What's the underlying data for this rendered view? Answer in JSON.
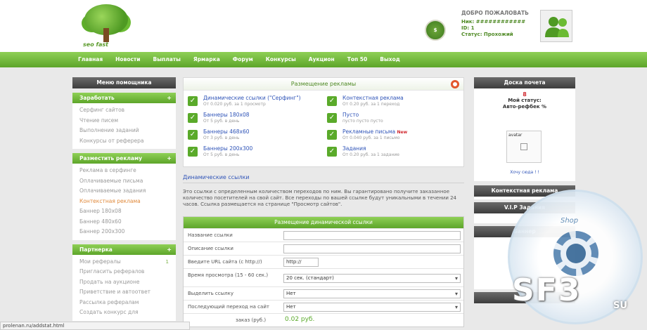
{
  "header": {
    "logo_text": "seo fast",
    "badge": "$",
    "welcome_title": "ДОБРО ПОЖАЛОВАТЬ",
    "login_row": "Ник: ############",
    "id_row": "ID: 1",
    "status_row": "Статус: Прохожий"
  },
  "nav": [
    "Главная",
    "Новости",
    "Выплаты",
    "Ярмарка",
    "Форум",
    "Конкурсы",
    "Аукцион",
    "Топ 50",
    "Выход"
  ],
  "left_menu": {
    "title": "Меню помощника",
    "sections": [
      {
        "title": "Заработать",
        "plus": "+",
        "items": [
          "Серфинг сайтов",
          "Чтение писем",
          "Выполнение заданий",
          "Конкурсы от реферера"
        ]
      },
      {
        "title": "Разместить рекламу",
        "plus": "+",
        "items": [
          "Реклама в серфинге",
          "Оплачиваемые письма",
          "Оплачиваемые задания",
          "Контекстная реклама",
          "Баннер 180х08",
          "Баннер 480х60",
          "Баннер 200х300"
        ],
        "active_index": 3
      },
      {
        "title": "Партнерка",
        "plus": "+",
        "items": [
          "Мои рефералы",
          "Пригласить рефералов",
          "Продать на аукционе",
          "Приветствие и автоответ",
          "Рассылка рефералам",
          "Создать конкурс для"
        ],
        "tiny_first": "1"
      }
    ]
  },
  "ads": {
    "title": "Размещение рекламы",
    "items": [
      {
        "title": "Динамические ссылки (\"Серфинг\")",
        "sub": "От 0.020 руб. за 1 просмотр"
      },
      {
        "title": "Контекстная реклама",
        "sub": "От 0.20 руб. за 1 переход"
      },
      {
        "title": "Баннеры 180х08",
        "sub": "От 5 руб. в день"
      },
      {
        "title": "Пусто",
        "sub": "пусто пусто пусто"
      },
      {
        "title": "Баннеры 468х60",
        "sub": "От 3 руб. в день"
      },
      {
        "title": "Рекламные письма",
        "sub": "От 0.040 руб. за 1 письмо",
        "new": "New"
      },
      {
        "title": "Баннеры 200х300",
        "sub": "От 5 руб. в день"
      },
      {
        "title": "Задания",
        "sub": "От 0.20 руб. за 1 задание"
      }
    ]
  },
  "section": {
    "title": "Динамические ссылки",
    "desc": "Это ссылки с определенным количеством переходов по ним. Вы гарантировано получите заказанное количество посетителей на свой сайт. Все переходы по вашей ссылке будут уникальными в течении 24 часов. Ссылка размещается на странице \"Просмотр сайтов\"."
  },
  "form": {
    "title": "Размещение динамической ссылки",
    "rows": [
      {
        "label": "Название ссылки",
        "value": ""
      },
      {
        "label": "Описание ссылки",
        "value": ""
      },
      {
        "label": "Введите URL сайта (с http://)",
        "value": "http://"
      },
      {
        "label": "Время просмотра (15 - 60 сек.)",
        "value": "20 сек. (стандарт)"
      },
      {
        "label": "Выделить ссылку",
        "value": "Нет"
      },
      {
        "label": "Последующий переход на сайт",
        "value": "Нет"
      }
    ],
    "price_label": "заказ (руб.)",
    "price": "0.02 руб."
  },
  "right": {
    "honor_title": "Доска почета",
    "honor_num": "8",
    "honor_status": "Мой статус:",
    "honor_user": "Авто-рефбек %",
    "avatar_alt": "avatar",
    "honor_link": "Хочу сюда ! !",
    "context_title": "Контекстная реклама",
    "vip_title": "V.I.P Задания",
    "banner1_title": "Баннер",
    "banner2_title": "Бан"
  },
  "watermark": {
    "shop": "Shop",
    "big": "SF3",
    "su": "SU"
  },
  "statusbar": "prolenan.ru/addstat.html",
  "colors": {
    "green": "#5da52a",
    "link": "#2f54b8",
    "dark": "#3d3d3d",
    "active": "#e08a3c"
  }
}
